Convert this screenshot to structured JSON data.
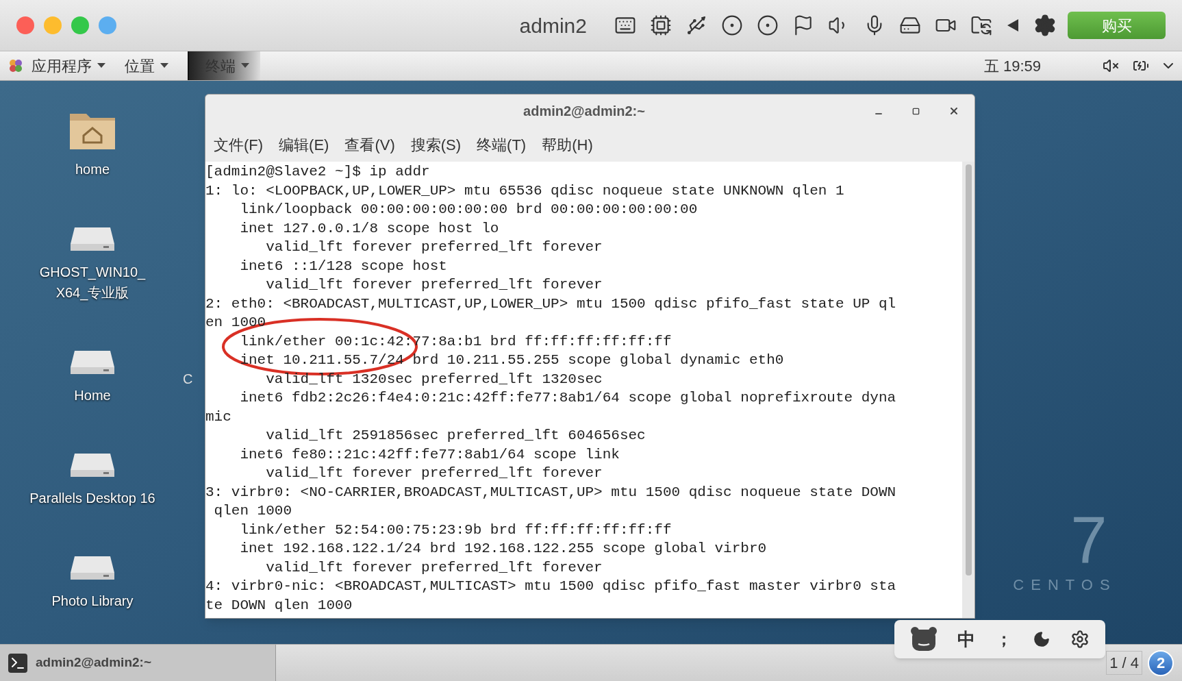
{
  "vm_window": {
    "title": "admin2",
    "buy_button": "购买"
  },
  "panel": {
    "menus": [
      "应用程序",
      "位置"
    ],
    "task": "终端",
    "clock": "五 19:59"
  },
  "desktop": {
    "icons": [
      {
        "kind": "folder",
        "label_lines": [
          "home"
        ]
      },
      {
        "kind": "drive",
        "label_lines": [
          "GHOST_WIN10_",
          "X64_专业版"
        ]
      },
      {
        "kind": "drive",
        "label_lines": [
          "Home"
        ]
      },
      {
        "kind": "drive",
        "label_lines": [
          "Parallels Desktop 16"
        ]
      },
      {
        "kind": "drive",
        "label_lines": [
          "Photo Library"
        ]
      }
    ],
    "hidden_label_fragment": "C",
    "logo": {
      "numeral": "7",
      "name": "CENTOS"
    }
  },
  "terminal": {
    "title": "admin2@admin2:~",
    "menu": [
      "文件(F)",
      "编辑(E)",
      "查看(V)",
      "搜索(S)",
      "终端(T)",
      "帮助(H)"
    ],
    "lines": [
      "[admin2@Slave2 ~]$ ip addr",
      "1: lo: <LOOPBACK,UP,LOWER_UP> mtu 65536 qdisc noqueue state UNKNOWN qlen 1",
      "    link/loopback 00:00:00:00:00:00 brd 00:00:00:00:00:00",
      "    inet 127.0.0.1/8 scope host lo",
      "       valid_lft forever preferred_lft forever",
      "    inet6 ::1/128 scope host",
      "       valid_lft forever preferred_lft forever",
      "2: eth0: <BROADCAST,MULTICAST,UP,LOWER_UP> mtu 1500 qdisc pfifo_fast state UP ql",
      "en 1000",
      "    link/ether 00:1c:42:77:8a:b1 brd ff:ff:ff:ff:ff:ff",
      "    inet 10.211.55.7/24 brd 10.211.55.255 scope global dynamic eth0",
      "       valid_lft 1320sec preferred_lft 1320sec",
      "    inet6 fdb2:2c26:f4e4:0:21c:42ff:fe77:8ab1/64 scope global noprefixroute dyna",
      "mic",
      "       valid_lft 2591856sec preferred_lft 604656sec",
      "    inet6 fe80::21c:42ff:fe77:8ab1/64 scope link",
      "       valid_lft forever preferred_lft forever",
      "3: virbr0: <NO-CARRIER,BROADCAST,MULTICAST,UP> mtu 1500 qdisc noqueue state DOWN",
      " qlen 1000",
      "    link/ether 52:54:00:75:23:9b brd ff:ff:ff:ff:ff:ff",
      "    inet 192.168.122.1/24 brd 192.168.122.255 scope global virbr0",
      "       valid_lft forever preferred_lft forever",
      "4: virbr0-nic: <BROADCAST,MULTICAST> mtu 1500 qdisc pfifo_fast master virbr0 sta",
      "te DOWN qlen 1000"
    ]
  },
  "input_method": {
    "language": "中",
    "punctuation": "；"
  },
  "taskbar": {
    "task": "admin2@admin2:~",
    "workspace": "1 / 4",
    "badge": "2"
  }
}
